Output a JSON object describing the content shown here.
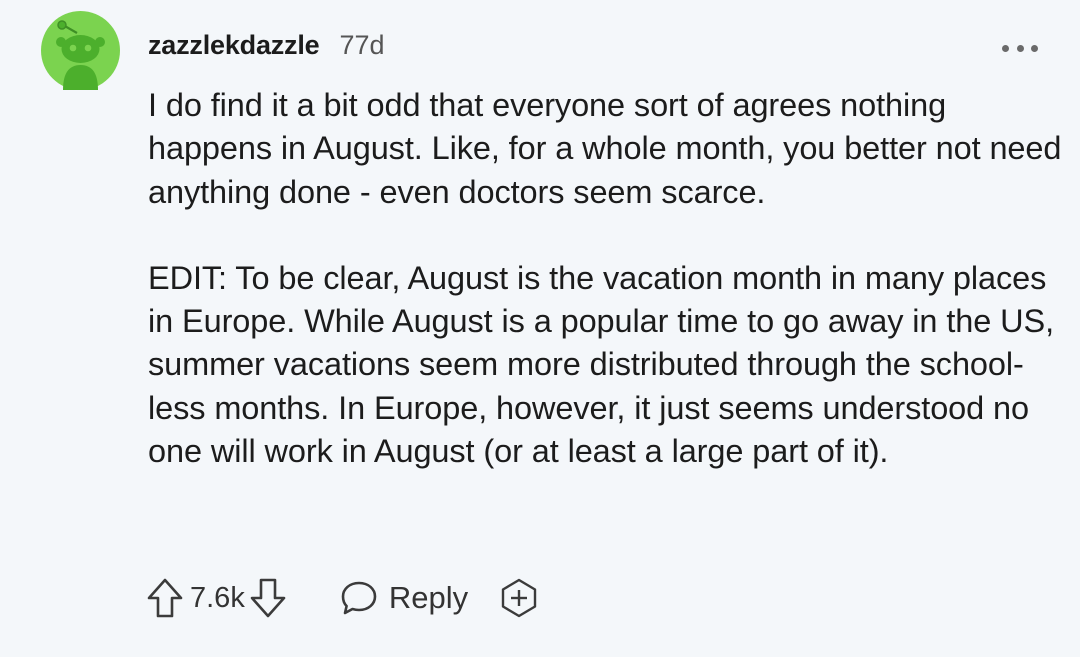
{
  "comment": {
    "username": "zazzlekdazzle",
    "age": "77d",
    "paragraphs": [
      "I do find it a bit odd that everyone sort of agrees nothing happens in August. Like, for a whole month, you better not need anything done - even doctors seem scarce.",
      "EDIT: To be clear, August is the vacation month in many places in Europe. While August is a popular time to go away in the US, summer vacations seem more distributed through the school-less months. In Europe, however, it just seems understood no one will work in August (or at least a large part of it)."
    ],
    "vote_count": "7.6k",
    "reply_label": "Reply",
    "avatar_bg": "#7bd34f",
    "avatar_fg": "#4caf2c"
  },
  "icons": {
    "more": "more-options-icon",
    "upvote": "upvote-arrow-icon",
    "downvote": "downvote-arrow-icon",
    "reply": "speech-bubble-icon",
    "award": "award-plus-icon",
    "avatar": "snoo-avatar-icon"
  }
}
